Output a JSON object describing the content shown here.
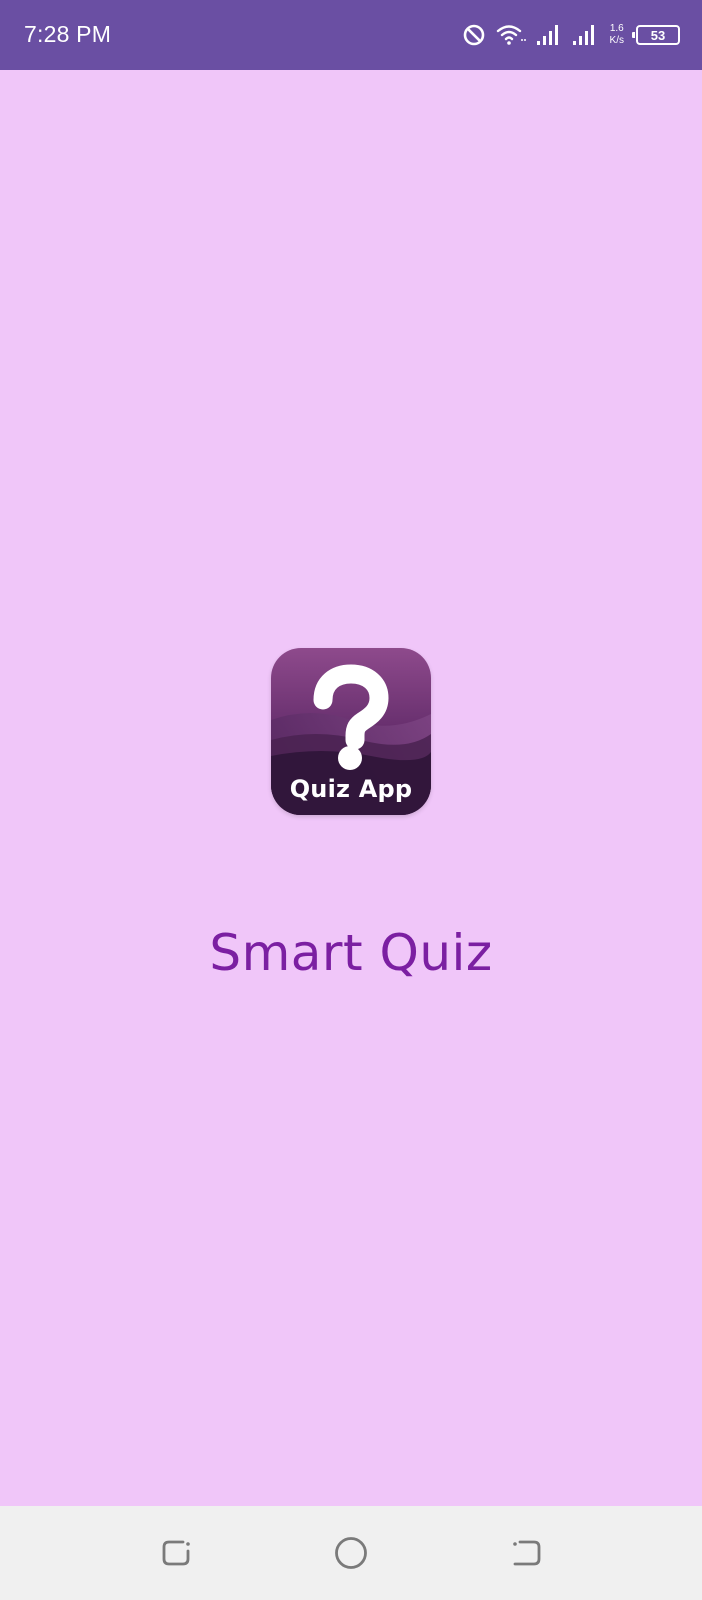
{
  "status_bar": {
    "time": "7:28 PM",
    "net_speed_value": "1.6",
    "net_speed_unit": "K/s",
    "battery_level": "53",
    "icons": [
      "do-not-disturb-icon",
      "wifi-icon",
      "signal-icon",
      "signal-icon-2",
      "battery-icon"
    ]
  },
  "splash": {
    "logo_caption": "Quiz App",
    "logo_symbol": "?",
    "app_title": "Smart Quiz"
  },
  "colors": {
    "background": "#f0c6f9",
    "status_bar": "#6a4fa3",
    "title": "#7b1fa2",
    "nav_bar": "#f0f0f0"
  },
  "nav_bar": {
    "icons": [
      "recent-apps-icon",
      "home-icon",
      "back-icon"
    ]
  }
}
